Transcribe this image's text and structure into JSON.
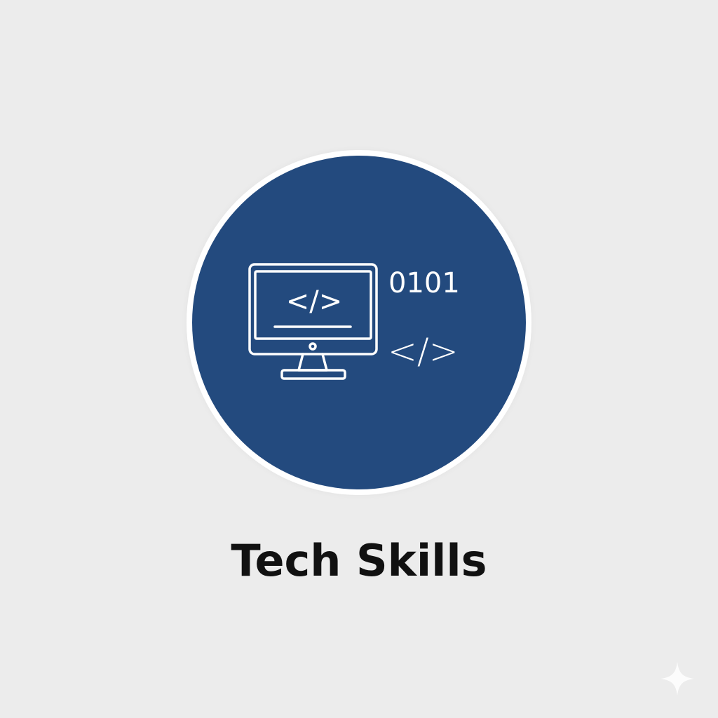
{
  "badge": {
    "background_color": "#234a7e",
    "ring_color": "#ffffff",
    "icon": "monitor-code-icon",
    "screen_code": "</>",
    "binary": "0101",
    "side_code": "</>"
  },
  "title": "Tech Skills",
  "corner_mark": {
    "icon": "sparkle-icon"
  }
}
